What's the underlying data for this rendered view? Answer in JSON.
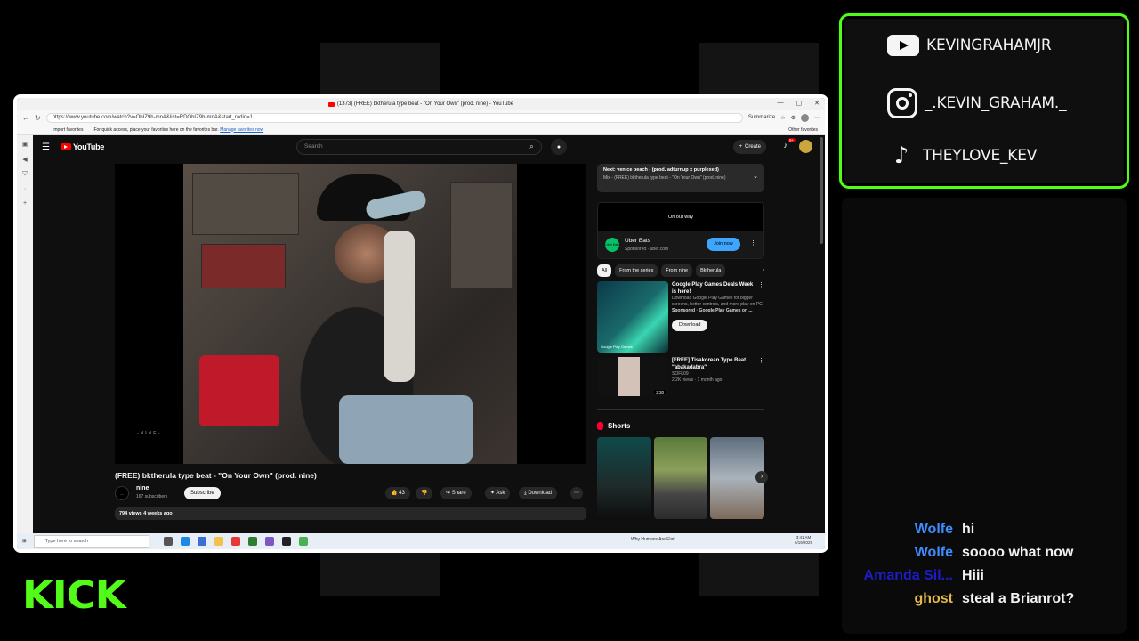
{
  "browser": {
    "tab_title": "(1373) (FREE) bktherula type beat - \"On Your Own\" (prod. nine) - YouTube",
    "window_controls": [
      "—",
      "▢",
      "✕"
    ],
    "url": "https://www.youtube.com/watch?v=ObIZ9h-mnA&list=RDObIZ9h-mnA&start_radio=1",
    "summarize": "Summarize",
    "favorites": {
      "import": "Import favorites",
      "hint": "For quick access, place your favorites here on the favorites bar.",
      "manage": "Manage favorites now",
      "other": "Other favorites"
    }
  },
  "youtube": {
    "logo_text": "YouTube",
    "search_placeholder": "Search",
    "create_label": "Create",
    "notification_badge": "9+",
    "video": {
      "watermark": "-NINE-",
      "title": "(FREE) bktherula type beat - \"On Your Own\" (prod. nine)",
      "channel": "nine",
      "subscribers": "167 subscribers",
      "subscribe_label": "Subscribe",
      "likes": "43",
      "share_label": "Share",
      "ask_label": "Ask",
      "download_label": "Download",
      "views": "794 views  4 weeks ago"
    },
    "next_up": {
      "title": "Next: venice beach - (prod. adturnup x purplexed)",
      "subtitle": "Mix - (FREE) bktherula type beat - \"On Your Own\" (prod. nine)"
    },
    "ad": {
      "video_text": "On our way",
      "logo_text": "Uber Eats",
      "brand": "Uber Eats",
      "sponsored": "Sponsored · uber.com",
      "cta": "Join now"
    },
    "chips": [
      "All",
      "From the series",
      "From nine",
      "Bktherula"
    ],
    "recommendations": [
      {
        "title": "Google Play Games Deals Week is here!",
        "description": "Download Google Play Games for bigger screens, better controls, and more play on PC.",
        "sponsor": "Sponsored · Google Play Games on ...",
        "thumb_text": "Google Play Games",
        "button": "Download"
      },
      {
        "title": "[FREE] Tisakorean Type Beat \"abakadabra\"",
        "channel": "SOFL09",
        "meta": "2.2K views · 1 month ago",
        "duration": "2:30"
      }
    ],
    "shorts_label": "Shorts"
  },
  "taskbar": {
    "search_placeholder": "Type here to search",
    "news": "Why Humans Are Flat...",
    "time": "3:41 AM",
    "date": "6/19/2025"
  },
  "social": {
    "youtube": "KEVINGRAHAMJR",
    "instagram": "_.KEVIN_GRAHAM._",
    "tiktok": "THEYLOVE_KEV"
  },
  "chat": [
    {
      "user": "Wolfe",
      "message": "hi",
      "color": "#3f8cff"
    },
    {
      "user": "Wolfe",
      "message": "soooo what now",
      "color": "#3f8cff"
    },
    {
      "user": "Amanda Sil...",
      "message": "Hiii",
      "color": "#1c1cc8"
    },
    {
      "user": "ghost",
      "message": "steal a Brianrot?",
      "color": "#e4b94a"
    }
  ],
  "brand": {
    "logo": "KICK",
    "accent": "#53fc18"
  }
}
